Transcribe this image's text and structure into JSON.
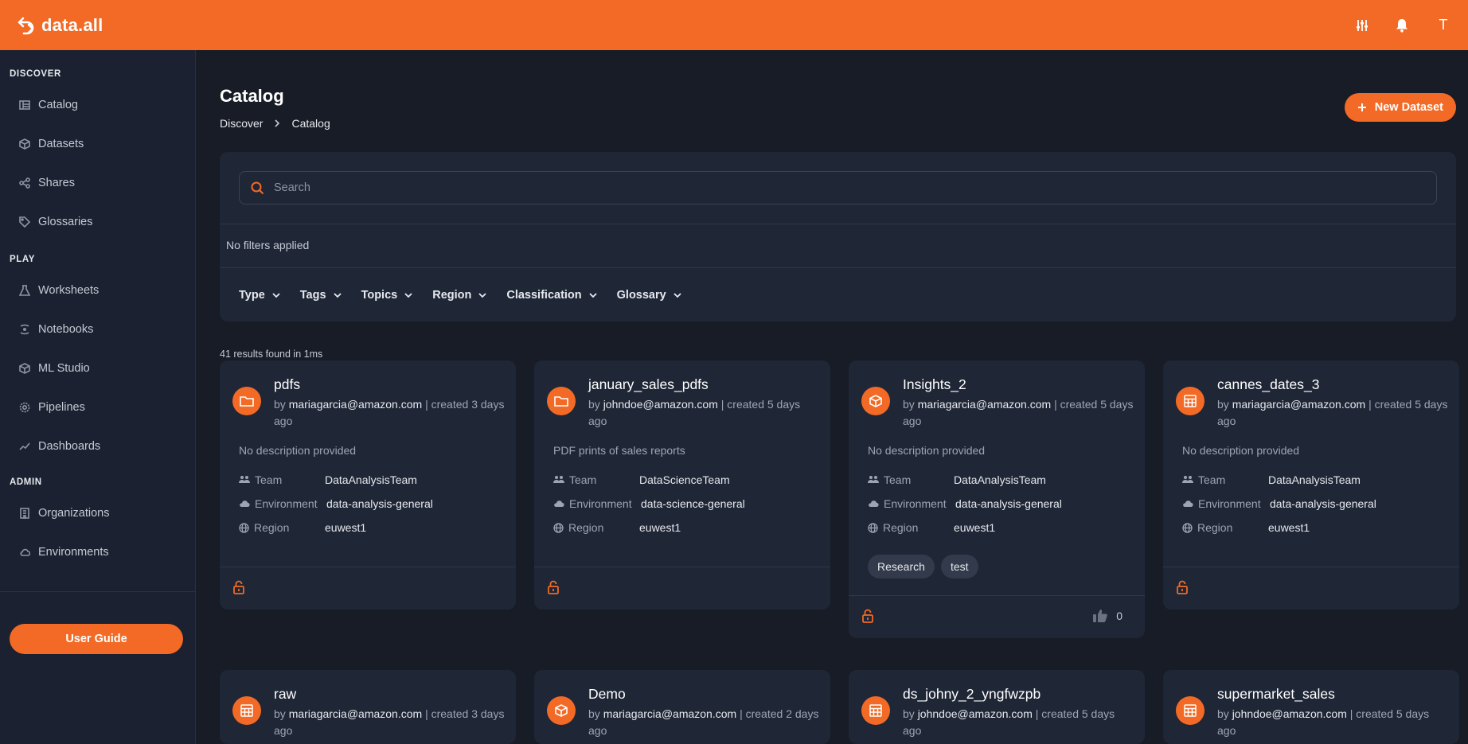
{
  "app": {
    "name": "data.all",
    "avatar": "T"
  },
  "sidebar": {
    "sections": [
      {
        "title": "DISCOVER",
        "items": [
          {
            "label": "Catalog",
            "icon": "catalog-icon"
          },
          {
            "label": "Datasets",
            "icon": "cube-icon"
          },
          {
            "label": "Shares",
            "icon": "share-icon"
          },
          {
            "label": "Glossaries",
            "icon": "tag-icon"
          }
        ]
      },
      {
        "title": "PLAY",
        "items": [
          {
            "label": "Worksheets",
            "icon": "flask-icon"
          },
          {
            "label": "Notebooks",
            "icon": "notebook-icon"
          },
          {
            "label": "ML Studio",
            "icon": "cube-icon"
          },
          {
            "label": "Pipelines",
            "icon": "gear-icon"
          },
          {
            "label": "Dashboards",
            "icon": "chart-icon"
          }
        ]
      },
      {
        "title": "ADMIN",
        "items": [
          {
            "label": "Organizations",
            "icon": "building-icon"
          },
          {
            "label": "Environments",
            "icon": "cloud-icon"
          }
        ]
      }
    ],
    "guide_label": "User Guide"
  },
  "page": {
    "title": "Catalog",
    "breadcrumb": [
      "Discover",
      "Catalog"
    ],
    "new_button": "New Dataset"
  },
  "search": {
    "placeholder": "Search"
  },
  "filters": {
    "status": "No filters applied",
    "buttons": [
      "Type",
      "Tags",
      "Topics",
      "Region",
      "Classification",
      "Glossary"
    ]
  },
  "results": {
    "text": "41 results found in 1ms"
  },
  "labels": {
    "team": "Team",
    "environment": "Environment",
    "region": "Region"
  },
  "cards": [
    {
      "title": "pdfs",
      "by": "by ",
      "owner": "mariagarcia@amazon.com",
      "created": " | created 3 days ago",
      "description": "No description provided",
      "team": "DataAnalysisTeam",
      "environment": "data-analysis-general",
      "region": "euwest1",
      "icon": "folder-icon"
    },
    {
      "title": "january_sales_pdfs",
      "by": "by ",
      "owner": "johndoe@amazon.com",
      "created": " | created 5 days ago",
      "description": "PDF prints of sales reports",
      "team": "DataScienceTeam",
      "environment": "data-science-general",
      "region": "euwest1",
      "icon": "folder-icon"
    },
    {
      "title": "Insights_2",
      "by": "by ",
      "owner": "mariagarcia@amazon.com",
      "created": " | created 5 days ago",
      "description": "No description provided",
      "team": "DataAnalysisTeam",
      "environment": "data-analysis-general",
      "region": "euwest1",
      "icon": "cube-icon",
      "tags": [
        "Research",
        "test"
      ],
      "likes": "0"
    },
    {
      "title": "cannes_dates_3",
      "by": "by ",
      "owner": "mariagarcia@amazon.com",
      "created": " | created 5 days ago",
      "description": "No description provided",
      "team": "DataAnalysisTeam",
      "environment": "data-analysis-general",
      "region": "euwest1",
      "icon": "table-icon"
    },
    {
      "title": "raw",
      "by": "by ",
      "owner": "mariagarcia@amazon.com",
      "created": " | created 3 days ago",
      "icon": "table-icon"
    },
    {
      "title": "Demo",
      "by": "by ",
      "owner": "mariagarcia@amazon.com",
      "created": " | created 2 days ago",
      "icon": "cube-icon"
    },
    {
      "title": "ds_johny_2_yngfwzpb",
      "by": "by ",
      "owner": "johndoe@amazon.com",
      "created": " | created 5 days ago",
      "icon": "table-icon"
    },
    {
      "title": "supermarket_sales",
      "by": "by ",
      "owner": "johndoe@amazon.com",
      "created": " | created 5 days ago",
      "icon": "table-icon"
    }
  ],
  "colors": {
    "accent": "#f26a25",
    "background": "#171c26",
    "card": "#1f2636"
  }
}
